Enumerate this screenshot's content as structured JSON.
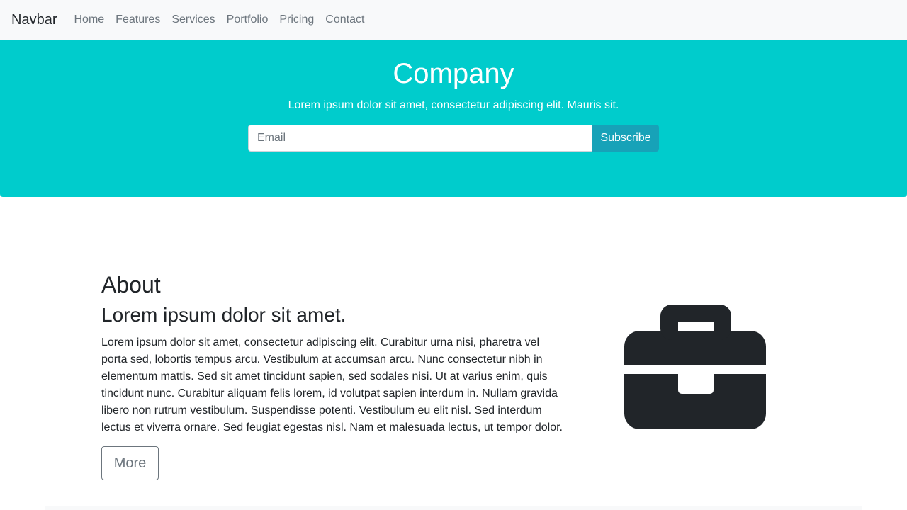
{
  "navbar": {
    "brand": "Navbar",
    "links": [
      "Home",
      "Features",
      "Services",
      "Portfolio",
      "Pricing",
      "Contact"
    ]
  },
  "hero": {
    "title": "Company",
    "subtitle": "Lorem ipsum dolor sit amet, consectetur adipiscing elit. Mauris sit.",
    "email_placeholder": "Email",
    "subscribe_label": "Subscribe",
    "background_color": "#00cccc",
    "button_color": "#17a2b8"
  },
  "about": {
    "title": "About",
    "lead": "Lorem ipsum dolor sit amet.",
    "body": "Lorem ipsum dolor sit amet, consectetur adipiscing elit. Curabitur urna nisi, pharetra vel porta sed, lobortis tempus arcu. Vestibulum at accumsan arcu. Nunc consectetur nibh in elementum mattis. Sed sit amet tincidunt sapien, sed sodales nisi. Ut at varius enim, quis tincidunt nunc. Curabitur aliquam felis lorem, id volutpat sapien interdum in. Nullam gravida libero non rutrum vestibulum. Suspendisse potenti. Vestibulum eu elit nisl. Sed interdum lectus et viverra ornare. Sed feugiat egestas nisl. Nam et malesuada lectus, ut tempor dolor.",
    "more_label": "More",
    "icon": "briefcase-icon"
  }
}
